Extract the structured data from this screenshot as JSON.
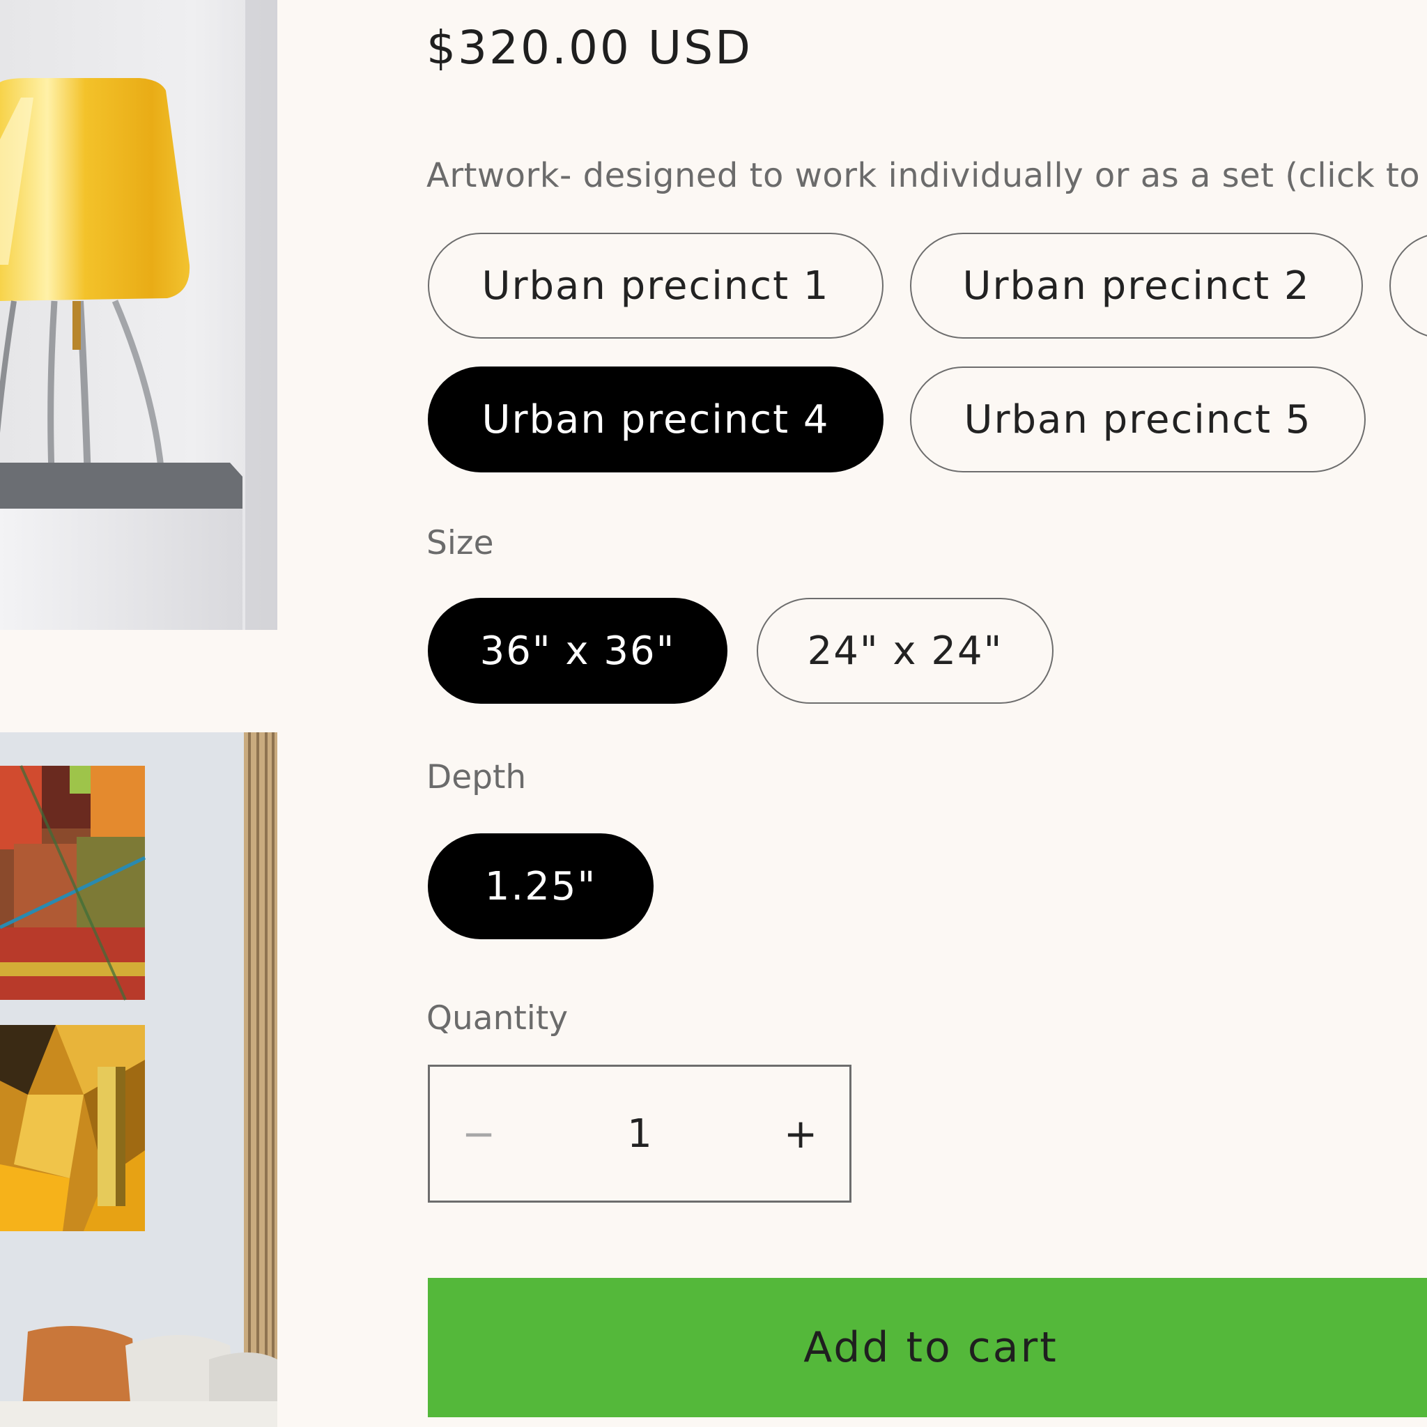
{
  "product": {
    "price": "$320.00 USD"
  },
  "options": {
    "artwork": {
      "label": "Artwork- designed to work individually or as a set (click to s",
      "values": [
        {
          "label": "Urban precinct 1",
          "selected": false
        },
        {
          "label": "Urban precinct 2",
          "selected": false
        },
        {
          "label": "Urban precinct 4",
          "selected": true
        },
        {
          "label": "Urban precinct 5",
          "selected": false
        }
      ]
    },
    "size": {
      "label": "Size",
      "values": [
        {
          "label": "36\" x 36\"",
          "selected": true
        },
        {
          "label": "24\" x 24\"",
          "selected": false
        }
      ]
    },
    "depth": {
      "label": "Depth",
      "values": [
        {
          "label": "1.25\"",
          "selected": true
        }
      ]
    }
  },
  "quantity": {
    "label": "Quantity",
    "value": "1",
    "minus": "−",
    "plus": "+"
  },
  "cart": {
    "add_label": "Add to cart"
  },
  "colors": {
    "background": "#fcf8f4",
    "selected_pill": "#000000",
    "add_to_cart": "#54b83a"
  },
  "images": [
    {
      "name": "yellow-lamp-photo"
    },
    {
      "name": "wall-art-photo"
    }
  ]
}
